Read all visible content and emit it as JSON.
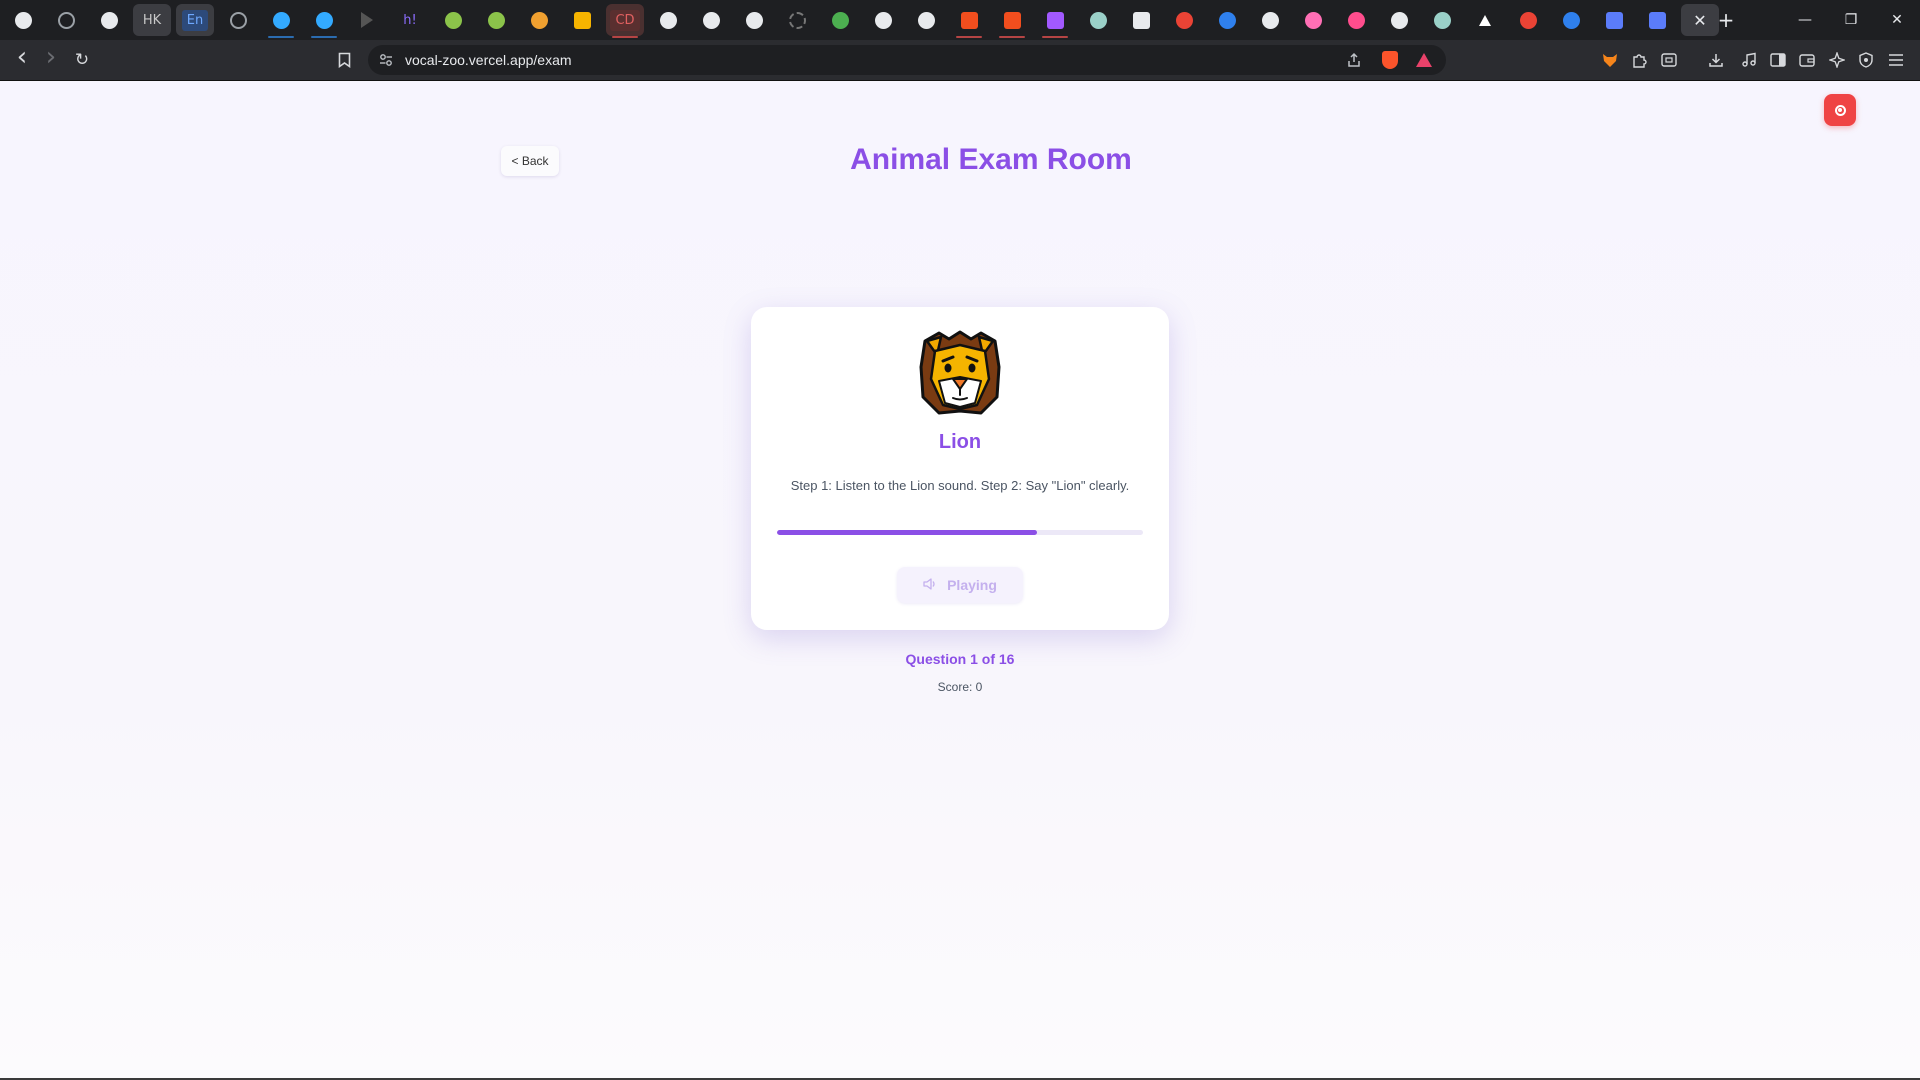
{
  "browser": {
    "tabs": [
      {
        "id": "t1",
        "icon": "perplexity-icon",
        "color": "#e8eaed"
      },
      {
        "id": "t2",
        "icon": "openai-icon",
        "color": "#bdbdbd"
      },
      {
        "id": "t3",
        "icon": "github-icon",
        "color": "#e8eaed"
      },
      {
        "id": "t4",
        "icon": "hk-icon",
        "label": "HK",
        "color": "#c8c8c8"
      },
      {
        "id": "t5",
        "icon": "en-icon",
        "label": "En",
        "color": "#6ea8ff"
      },
      {
        "id": "t6",
        "icon": "openai-icon",
        "color": "#bdbdbd"
      },
      {
        "id": "t7",
        "icon": "kraken-icon",
        "color": "#33aaff"
      },
      {
        "id": "t8",
        "icon": "kraken-icon",
        "color": "#33aaff"
      },
      {
        "id": "t9",
        "icon": "play-icon",
        "color": "#555555"
      },
      {
        "id": "t10",
        "icon": "hashnode-icon",
        "label": "h!",
        "color": "#8c6dff"
      },
      {
        "id": "t11",
        "icon": "globe-icon",
        "color": "#8bc34a"
      },
      {
        "id": "t12",
        "icon": "globe-icon",
        "color": "#8bc34a"
      },
      {
        "id": "t13",
        "icon": "moon-icon",
        "color": "#f0a030"
      },
      {
        "id": "t14",
        "icon": "keep-icon",
        "color": "#f6b400"
      },
      {
        "id": "t15",
        "icon": "cd-icon",
        "label": "CD",
        "color": "#e06060"
      },
      {
        "id": "t16",
        "icon": "github-icon",
        "color": "#e8eaed"
      },
      {
        "id": "t17",
        "icon": "github-icon",
        "color": "#e8eaed"
      },
      {
        "id": "t18",
        "icon": "github-icon",
        "color": "#e8eaed"
      },
      {
        "id": "t19",
        "icon": "loading-icon",
        "color": "#777777"
      },
      {
        "id": "t20",
        "icon": "green-circle-icon",
        "color": "#4caf50"
      },
      {
        "id": "t21",
        "icon": "github-icon",
        "color": "#e8eaed"
      },
      {
        "id": "t22",
        "icon": "github-icon",
        "color": "#e8eaed"
      },
      {
        "id": "t23",
        "icon": "figma-icon",
        "color": "#f24e1e"
      },
      {
        "id": "t24",
        "icon": "figma-icon",
        "color": "#f24e1e"
      },
      {
        "id": "t25",
        "icon": "figma-icon",
        "color": "#a259ff"
      },
      {
        "id": "t26",
        "icon": "vercel-globe-icon",
        "color": "#9ad0c8"
      },
      {
        "id": "t27",
        "icon": "calendar-icon",
        "color": "#e8eaed"
      },
      {
        "id": "t28",
        "icon": "gmail-icon",
        "color": "#ea4335"
      },
      {
        "id": "t29",
        "icon": "globe-icon",
        "color": "#2f80ed"
      },
      {
        "id": "t30",
        "icon": "github-icon",
        "color": "#e8eaed"
      },
      {
        "id": "t31",
        "icon": "pinwheel-icon",
        "color": "#ff6fb5"
      },
      {
        "id": "t32",
        "icon": "arc-icon",
        "color": "#ff4d8d"
      },
      {
        "id": "t33",
        "icon": "github-icon",
        "color": "#e8eaed"
      },
      {
        "id": "t34",
        "icon": "vercel-globe-icon",
        "color": "#9ad0c8"
      },
      {
        "id": "t35",
        "icon": "vercel-icon",
        "color": "#ffffff"
      },
      {
        "id": "t36",
        "icon": "gmail-icon",
        "color": "#ea4335"
      },
      {
        "id": "t37",
        "icon": "cursor-icon",
        "color": "#2f80ed"
      },
      {
        "id": "t38",
        "icon": "app-icon",
        "color": "#5b7cfa"
      },
      {
        "id": "t39",
        "icon": "app-icon",
        "color": "#5b7cfa"
      }
    ],
    "active_tab_close": "✕",
    "new_tab": "+",
    "window_controls": {
      "minimize": "—",
      "restore": "❐",
      "close": "✕"
    },
    "toolbar": {
      "back": "‹",
      "forward": "›",
      "reload": "↻",
      "bookmark": "⌑",
      "url": "vocal-zoo.vercel.app/exam",
      "icons": [
        "share-icon",
        "brave-shields-icon",
        "brave-rewards-icon",
        "extension-fox-icon",
        "extensions-icon",
        "screenshot-icon",
        "downloads-icon",
        "media-icon",
        "sidebar-icon",
        "wallet-icon",
        "leo-ai-icon",
        "vpn-icon",
        "menu-icon"
      ]
    }
  },
  "page": {
    "back_label": "< Back",
    "title": "Animal Exam Room",
    "card": {
      "animal_emoji_icon": "lion-face-icon",
      "animal_name": "Lion",
      "instructions": "Step 1: Listen to the Lion sound. Step 2: Say \"Lion\" clearly.",
      "progress": 0.71,
      "button_label": "Playing"
    },
    "question_counter": "Question 1 of 16",
    "score": "Score: 0",
    "record_icon": "record-icon",
    "colors": {
      "accent": "#8b4fe6",
      "record": "#ef4444"
    }
  }
}
